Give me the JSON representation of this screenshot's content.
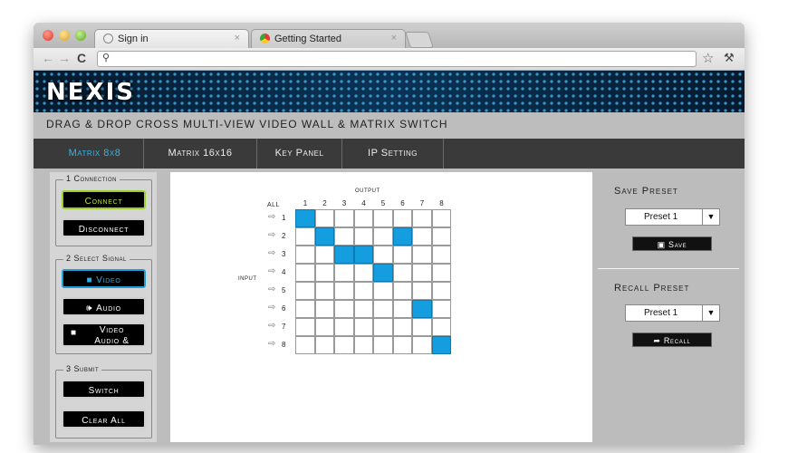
{
  "browser": {
    "tabs": [
      {
        "title": "Sign in"
      },
      {
        "title": "Getting Started"
      }
    ],
    "close_glyph": "×",
    "icons": {
      "back": "arrow-left-icon",
      "forward": "arrow-right-icon",
      "reload": "reload-icon",
      "search": "search-icon",
      "bookmark": "star-icon",
      "menu": "wrench-icon"
    }
  },
  "app": {
    "logo": "NEXIS",
    "subtitle": "DRAG & DROP CROSS MULTI-VIEW VIDEO WALL & MATRIX SWITCH",
    "nav": [
      {
        "label": "Matrix 8x8",
        "active": true
      },
      {
        "label": "Matrix 16x16",
        "active": false
      },
      {
        "label": "Key Panel",
        "active": false
      },
      {
        "label": "IP Setting",
        "active": false
      }
    ],
    "accent_color": "#1e9ed8",
    "connect_color": "#9ccf2d"
  },
  "left_panel": {
    "connection": {
      "legend": "1 Connection",
      "connect": "Connect",
      "disconnect": "Disconnect"
    },
    "signal": {
      "legend": "2 Select Signal",
      "video": "Video",
      "audio": "Audio",
      "video_audio_line1": "Video",
      "video_audio_line2": "Audio &"
    },
    "submit": {
      "legend": "3 Submit",
      "switch": "Switch",
      "clear_all": "Clear All"
    }
  },
  "matrix": {
    "output_label": "output",
    "input_label": "input",
    "all_label": "ALL",
    "outputs": [
      "1",
      "2",
      "3",
      "4",
      "5",
      "6",
      "7",
      "8"
    ],
    "inputs": [
      "1",
      "2",
      "3",
      "4",
      "5",
      "6",
      "7",
      "8"
    ],
    "routes": [
      {
        "input": 1,
        "outputs": [
          1
        ]
      },
      {
        "input": 2,
        "outputs": [
          2,
          6
        ]
      },
      {
        "input": 3,
        "outputs": [
          3,
          4
        ]
      },
      {
        "input": 4,
        "outputs": [
          5
        ]
      },
      {
        "input": 5,
        "outputs": []
      },
      {
        "input": 6,
        "outputs": [
          7
        ]
      },
      {
        "input": 7,
        "outputs": []
      },
      {
        "input": 8,
        "outputs": [
          8
        ]
      }
    ]
  },
  "right_panel": {
    "save_heading": "Save Preset",
    "save_select": "Preset 1",
    "save_button": "Save",
    "recall_heading": "Recall Preset",
    "recall_select": "Preset 1",
    "recall_button": "Recall"
  }
}
